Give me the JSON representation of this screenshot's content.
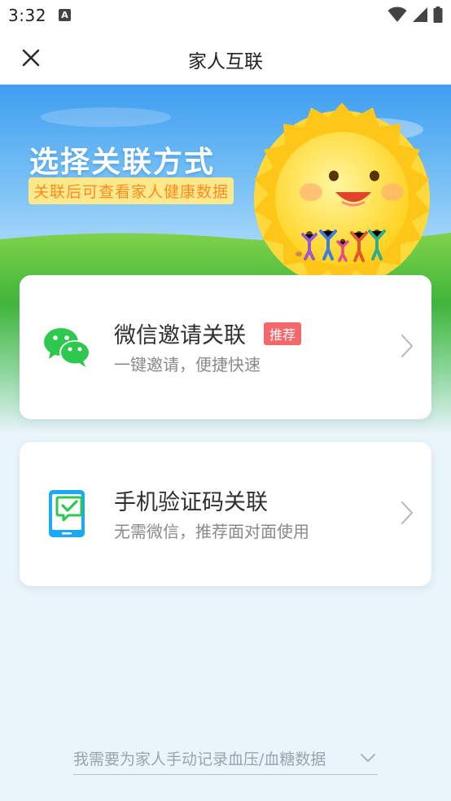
{
  "status_bar": {
    "time": "3:32",
    "a_icon": "A",
    "icons": [
      "a-notification-icon",
      "wifi-icon",
      "signal-icon",
      "battery-icon"
    ]
  },
  "header": {
    "title": "家人互联",
    "close_icon": "close-icon"
  },
  "banner": {
    "title": "选择关联方式",
    "subtitle": "关联后可查看家人健康数据"
  },
  "options": [
    {
      "title": "微信邀请关联",
      "badge": "推荐",
      "description": "一键邀请，便捷快速",
      "icon": "wechat-icon"
    },
    {
      "title": "手机验证码关联",
      "description": "无需微信，推荐面对面使用",
      "icon": "phone-verify-icon"
    }
  ],
  "footer": {
    "manual_entry": "我需要为家人手动记录血压/血糖数据",
    "icon": "chevron-down-icon"
  },
  "colors": {
    "wechat_green": "#2dc84d",
    "phone_blue": "#1aa9f5",
    "badge_red": "#f4676b",
    "sky_blue": "#4fa8f0",
    "grass_green": "#5fc43b"
  }
}
